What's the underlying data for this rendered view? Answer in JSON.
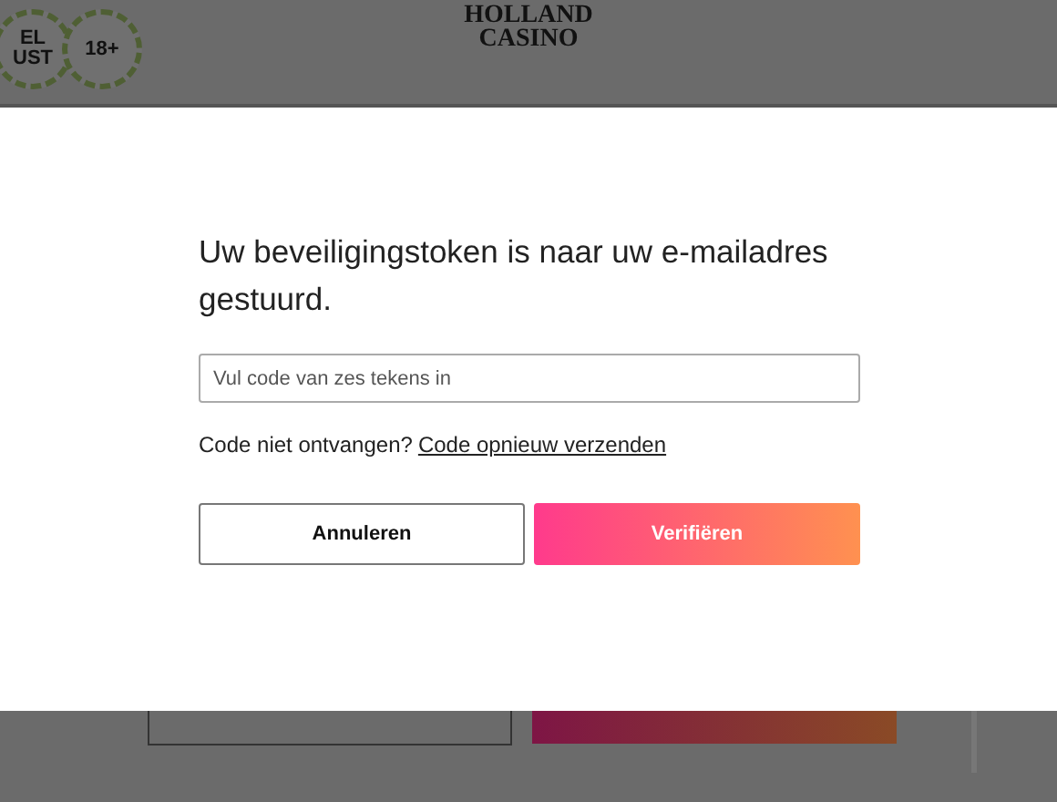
{
  "header": {
    "logo": {
      "line1": "HOLLAND",
      "line2": "CASINO"
    },
    "badges": [
      {
        "lines": [
          "EL",
          "UST"
        ]
      },
      {
        "lines": [
          "18+"
        ]
      }
    ]
  },
  "background_buttons": [
    {
      "kind": "outline"
    },
    {
      "kind": "gradient"
    }
  ],
  "dialog": {
    "title": "Uw beveiligingstoken is naar uw e-mailadres gestuurd.",
    "code_field": {
      "placeholder": "Vul code van zes tekens in"
    },
    "resend_prompt": "Code niet ontvangen?",
    "resend_link": "Code opnieuw verzenden",
    "buttons": [
      {
        "label": "Annuleren",
        "kind": "secondary"
      },
      {
        "label": "Verifiëren",
        "kind": "primary"
      }
    ]
  }
}
